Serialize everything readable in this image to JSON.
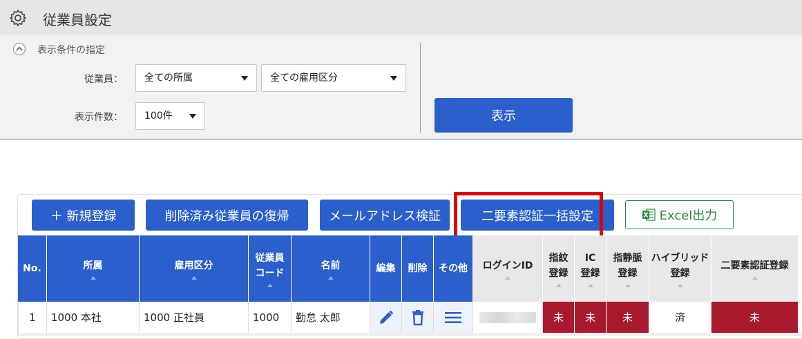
{
  "header": {
    "title": "従業員設定",
    "icon": "gear-icon"
  },
  "filter": {
    "section_title": "表示条件の指定",
    "employee_label": "従業員：",
    "dept_select": "全ての所属",
    "emp_type_select": "全ての雇用区分",
    "count_label": "表示件数：",
    "count_select": "100件",
    "show_button": "表示"
  },
  "toolbar": {
    "new_button": "＋ 新規登録",
    "restore_button": "削除済み従業員の復帰",
    "email_verify_button": "メールアドレス検証",
    "twofa_bulk_button": "二要素認証一括設定",
    "excel_button": "Excel出力"
  },
  "table": {
    "headers": {
      "no": "No.",
      "dept": "所属",
      "emp_type": "雇用区分",
      "code_l1": "従業員",
      "code_l2": "コード",
      "name": "名前",
      "edit": "編集",
      "delete": "削除",
      "other": "その他",
      "login_id": "ログインID",
      "finger_l1": "指紋",
      "finger_l2": "登録",
      "ic_l1": "IC",
      "ic_l2": "登録",
      "vein_l1": "指静脈",
      "vein_l2": "登録",
      "hybrid_l1": "ハイブリッド",
      "hybrid_l2": "登録",
      "twofa": "二要素認証登録"
    },
    "rows": [
      {
        "no": "1",
        "dept": "1000 本社",
        "emp_type": "1000 正社員",
        "code": "1000",
        "name": "勤怠 太郎",
        "finger": "未",
        "ic": "未",
        "vein": "未",
        "hybrid": "済",
        "twofa": "未"
      }
    ]
  },
  "colors": {
    "primary": "#2a5fcc",
    "highlight": "#e00000",
    "status_red": "#a8192e",
    "excel_green": "#2d8a4a"
  }
}
